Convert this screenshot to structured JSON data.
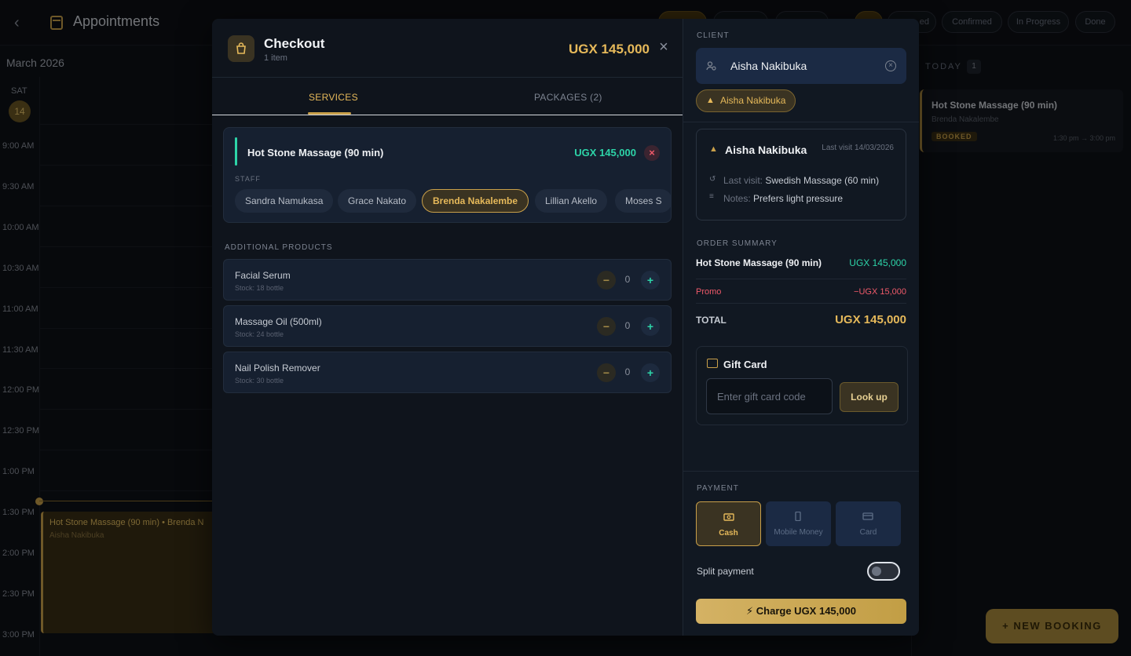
{
  "app": {
    "title": "Appointments",
    "month": "March 2026",
    "day_name": "SAT",
    "day_number": "14",
    "filters": [
      "",
      "",
      "Confirmed",
      "In Progress",
      "Done"
    ],
    "filter_partial": "ed",
    "times": [
      "9:00 AM",
      "9:30 AM",
      "10:00 AM",
      "10:30 AM",
      "11:00 AM",
      "11:30 AM",
      "12:00 PM",
      "12:30 PM",
      "1:00 PM",
      "1:30 PM",
      "2:00 PM",
      "2:30 PM",
      "3:00 PM"
    ],
    "calendar_event": {
      "title": "Hot Stone Massage (90 min)  •  Brenda N",
      "client": "Aisha Nakibuka"
    },
    "today": {
      "label": "TODAY",
      "count": "1",
      "card": {
        "title": "Hot Stone Massage (90 min)",
        "staff": "Brenda Nakalembe",
        "status": "BOOKED",
        "time": "1:30 pm → 3:00 pm"
      }
    },
    "new_booking": "NEW BOOKING"
  },
  "checkout": {
    "title": "Checkout",
    "subtitle": "1 item",
    "total": "UGX 145,000",
    "close_icon": "close-icon",
    "tabs": [
      {
        "label": "SERVICES",
        "active": true
      },
      {
        "label": "PACKAGES (2)",
        "active": false
      }
    ],
    "service": {
      "name": "Hot Stone Massage (90 min)",
      "price": "UGX 145,000",
      "staff_label": "STAFF",
      "staff": [
        "Sandra Namukasa",
        "Grace Nakato",
        "Brenda Nakalembe",
        "Lillian Akello",
        "Moses S"
      ],
      "selected_staff": "Brenda Nakalembe"
    },
    "additional_label": "ADDITIONAL PRODUCTS",
    "products": [
      {
        "name": "Facial Serum",
        "stock": "Stock: 18 bottle",
        "qty": "0"
      },
      {
        "name": "Massage Oil (500ml)",
        "stock": "Stock: 24 bottle",
        "qty": "0"
      },
      {
        "name": "Nail Polish Remover",
        "stock": "Stock: 30 bottle",
        "qty": "0"
      }
    ]
  },
  "client": {
    "label": "CLIENT",
    "value": "Aisha Nakibuka",
    "chip": "Aisha Nakibuka",
    "card_name": "Aisha Nakibuka",
    "last_visit_short": "Last visit 14/03/2026",
    "last_visit_label": "Last visit:",
    "last_visit_value": "Swedish Massage (60 min)",
    "notes_label": "Notes:",
    "notes_value": "Prefers light pressure"
  },
  "summary": {
    "label": "ORDER SUMMARY",
    "item_name": "Hot Stone Massage (90 min)",
    "item_price": "UGX 145,000",
    "promo_label": "Promo",
    "promo_value": "−UGX 15,000",
    "total_label": "TOTAL",
    "total_value": "UGX 145,000"
  },
  "gift_card": {
    "title": "Gift Card",
    "placeholder": "Enter gift card code",
    "lookup": "Look up"
  },
  "payment": {
    "label": "PAYMENT",
    "methods": [
      {
        "label": "Cash",
        "icon": "cash-icon",
        "selected": true
      },
      {
        "label": "Mobile Money",
        "icon": "phone-icon",
        "selected": false
      },
      {
        "label": "Card",
        "icon": "card-icon",
        "selected": false
      }
    ],
    "split_label": "Split payment",
    "split_on": false,
    "charge": "Charge UGX 145,000"
  },
  "colors": {
    "accent": "#c9a04a",
    "positive": "#2dd4a8",
    "negative": "#f05a6a"
  }
}
